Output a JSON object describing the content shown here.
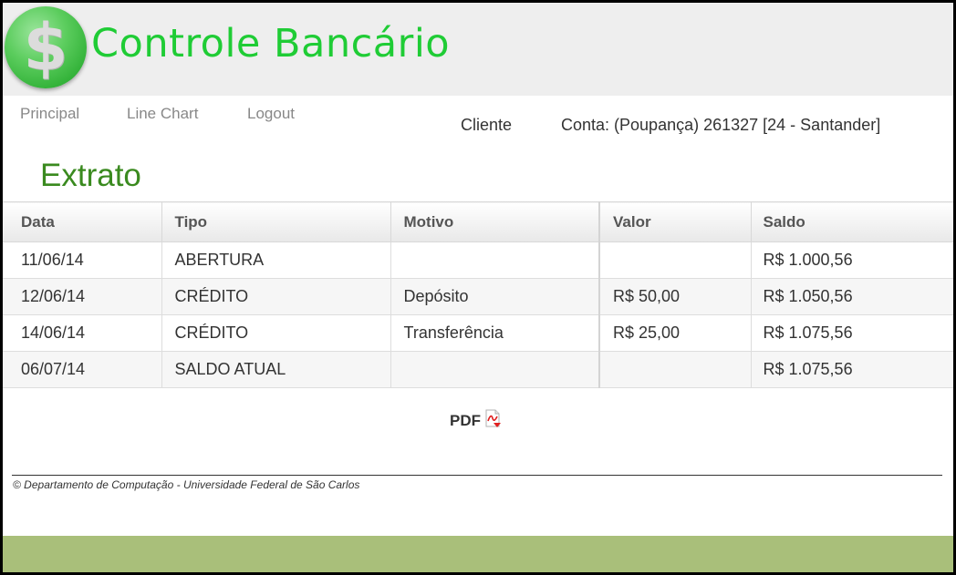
{
  "header": {
    "logo_glyph": "$",
    "app_title": "Controle Bancário"
  },
  "nav": {
    "items": [
      {
        "label": "Principal"
      },
      {
        "label": "Line Chart"
      },
      {
        "label": "Logout"
      }
    ]
  },
  "account": {
    "client_label": "Cliente",
    "account_label": "Conta: (Poupança) 261327 [24 - Santander]"
  },
  "page_title": "Extrato",
  "table": {
    "headers": [
      "Data",
      "Tipo",
      "Motivo",
      "Valor",
      "Saldo"
    ],
    "rows": [
      {
        "data": "11/06/14",
        "tipo": "ABERTURA",
        "motivo": "",
        "valor": "",
        "saldo": "R$ 1.000,56"
      },
      {
        "data": "12/06/14",
        "tipo": "CRÉDITO",
        "motivo": "Depósito",
        "valor": "R$ 50,00",
        "saldo": "R$ 1.050,56"
      },
      {
        "data": "14/06/14",
        "tipo": "CRÉDITO",
        "motivo": "Transferência",
        "valor": "R$ 25,00",
        "saldo": "R$ 1.075,56"
      },
      {
        "data": "06/07/14",
        "tipo": "SALDO ATUAL",
        "motivo": "",
        "valor": "",
        "saldo": "R$ 1.075,56"
      }
    ]
  },
  "pdf": {
    "label": "PDF",
    "icon": "pdf-download-icon"
  },
  "footer": {
    "text": "© Departamento de Computação - Universidade Federal de São Carlos"
  },
  "colors": {
    "title_green": "#1fcc35",
    "page_title_green": "#3a8a1f",
    "bottom_bar": "#a9bf7a",
    "header_bg": "#eeeeee"
  }
}
